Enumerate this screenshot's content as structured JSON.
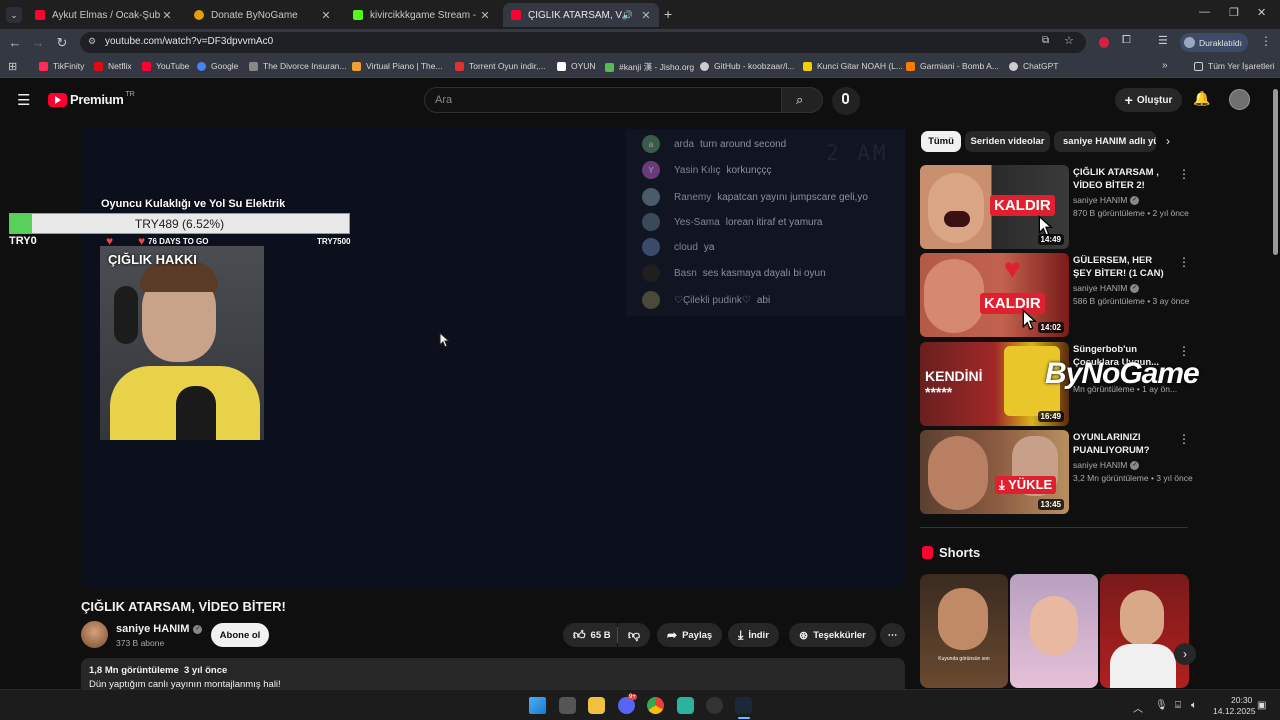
{
  "browser": {
    "tabs": [
      {
        "title": "Aykut Elmas / Ocak-Şubat-Mart",
        "color": "#ff0033"
      },
      {
        "title": "Donate ByNoGame",
        "color": "#e0a000"
      },
      {
        "title": "kivircikkkgame Stream - Watch",
        "color": "#53fc18"
      },
      {
        "title": "ÇIĞLIK ATARSAM, VİDEO BİTER!",
        "color": "#ff0033"
      }
    ],
    "url": "youtube.com/watch?v=DF3dpvvmAc0",
    "profile_label": "Duraklatıldı",
    "bookmarks": [
      {
        "label": "TikFinity",
        "color": "#ff2d55"
      },
      {
        "label": "Netflix",
        "color": "#e50914"
      },
      {
        "label": "YouTube",
        "color": "#ff0033"
      },
      {
        "label": "Google",
        "color": "#4285f4"
      },
      {
        "label": "The Divorce Insuran...",
        "color": "#888888"
      },
      {
        "label": "Virtual Piano | The...",
        "color": "#f0a030"
      },
      {
        "label": "Torrent Oyun indir,...",
        "color": "#d33"
      },
      {
        "label": "OYUN",
        "color": "#ffffff"
      },
      {
        "label": "#kanji 漢 - Jisho.org",
        "color": "#55bb55"
      },
      {
        "label": "GitHub - koobzaar/l...",
        "color": "#cccccc"
      },
      {
        "label": "Kunci Gitar NOAH (L...",
        "color": "#f0d000"
      },
      {
        "label": "Garmiani - Bomb A...",
        "color": "#ff7a00"
      },
      {
        "label": "ChatGPT",
        "color": "#cccccc"
      }
    ],
    "all_bookmarks": "Tüm Yer İşaretleri"
  },
  "header": {
    "logo_text": "Premium",
    "logo_region": "TR",
    "search_placeholder": "Ara",
    "create_label": "Oluştur"
  },
  "video": {
    "overlay_clock": "2 AM",
    "chat": [
      {
        "user": "arda",
        "message": "turn around second",
        "initial": "a",
        "color": "#3a5a4a"
      },
      {
        "user": "Yasin Kılıç",
        "message": "korkunççç",
        "initial": "Y",
        "color": "#6a3a7a"
      },
      {
        "user": "Ranemy",
        "message": "kapatcan yayını jumpscare geli,yo",
        "initial": "",
        "color": "#4a5a6a"
      },
      {
        "user": "Yes-Sama",
        "message": "lorean itiraf et yamura",
        "initial": "",
        "color": "#3a4a5a"
      },
      {
        "user": "cloud",
        "message": "ya",
        "initial": "",
        "color": "#3a4a6a"
      },
      {
        "user": "Basn",
        "message": "ses kasmaya dayalı bi oyun",
        "initial": "",
        "color": "#2a2a2a"
      },
      {
        "user": "♡Çilekli pudink♡",
        "message": "abi",
        "initial": "",
        "color": "#4a4a3a"
      }
    ],
    "donation": {
      "goal_title": "Oyuncu Kulaklığı ve Yol Su Elektrik",
      "amount_text": "TRY489 (6.52%)",
      "progress": 0.0652,
      "min_label": "TRY0",
      "days_label": "76 DAYS TO GO",
      "max_label": "TRY7500"
    },
    "cam_label": "ÇIĞLIK HAKKI",
    "title": "ÇIĞLIK ATARSAM, VİDEO BİTER!"
  },
  "channel": {
    "name": "saniye HANIM",
    "subs": "373 B abone",
    "subscribe_label": "Abone ol"
  },
  "actions": {
    "likes": "65 B",
    "share": "Paylaş",
    "download": "İndir",
    "thanks": "Teşekkürler"
  },
  "description": {
    "stats": "1,8 Mn görüntüleme  3 yıl önce",
    "text": "Dün yaptığım canlı yayının montajlanmış hali!"
  },
  "chips": [
    "Tümü",
    "Seriden videolar",
    "saniye HANIM adlı yü"
  ],
  "recommendations": [
    {
      "title": "ÇIĞLIK ATARSAM , VİDEO BİTER 2!",
      "channel": "saniye HANIM",
      "meta": "870 B görüntüleme • 2 yıl önce",
      "duration": "14:49",
      "thumb_text": "KALDIR"
    },
    {
      "title": "GÜLERSEM, HER ŞEY BİTER! (1 CAN)",
      "channel": "saniye HANIM",
      "meta": "586 B görüntüleme • 3 ay önce",
      "duration": "14:02",
      "thumb_text": "KALDIR"
    },
    {
      "title": "Süngerbob'un Çocuklara Uygun...",
      "channel": "",
      "meta": "Mn görüntüleme • 1 ay ön...",
      "duration": "16:49",
      "thumb_text": "KENDİNİ *****"
    },
    {
      "title": "OYUNLARINIZI PUANLIYORUM?",
      "channel": "saniye HANIM",
      "meta": "3,2 Mn görüntüleme • 3 yıl önce",
      "duration": "13:45",
      "thumb_text": "YÜKLE"
    }
  ],
  "overlay_watermark": "ByNoGame",
  "shorts": {
    "heading": "Shorts",
    "first_caption": "Kuyunda görünsün son"
  },
  "taskbar": {
    "time": "20:30",
    "date": "14.12.2025",
    "discord_badge": "9+"
  }
}
